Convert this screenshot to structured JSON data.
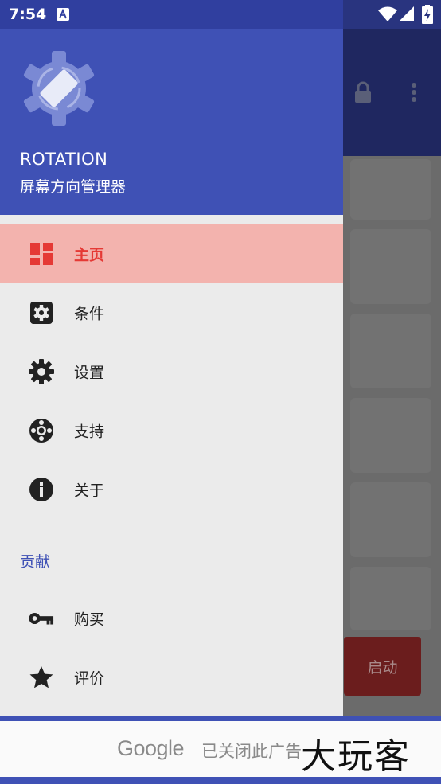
{
  "status_bar": {
    "time": "7:54",
    "icons": [
      "text-notification-icon",
      "wifi-icon",
      "signal-icon",
      "battery-charging-icon"
    ]
  },
  "background_app": {
    "toolbar_icons": [
      "lock-icon",
      "more-vert-icon"
    ],
    "start_button_label": "启动"
  },
  "drawer": {
    "header": {
      "app_name": "ROTATION",
      "subtitle": "屏幕方向管理器",
      "logo": "rotation-gear-logo"
    },
    "items": [
      {
        "label": "主页",
        "icon": "dashboard-icon",
        "active": true
      },
      {
        "label": "条件",
        "icon": "settings-box-icon",
        "active": false
      },
      {
        "label": "设置",
        "icon": "gear-icon",
        "active": false
      },
      {
        "label": "支持",
        "icon": "lifebuoy-icon",
        "active": false
      },
      {
        "label": "关于",
        "icon": "info-icon",
        "active": false
      }
    ],
    "section_title": "贡献",
    "section_items": [
      {
        "label": "购买",
        "icon": "key-icon"
      },
      {
        "label": "评价",
        "icon": "star-icon"
      }
    ]
  },
  "ad": {
    "brand": "Google",
    "closed_text": "已关闭此广告",
    "watermark": "大玩客"
  },
  "colors": {
    "primary": "#3f51b5",
    "accent": "#e53935",
    "active_bg": "#f3b3ae"
  }
}
